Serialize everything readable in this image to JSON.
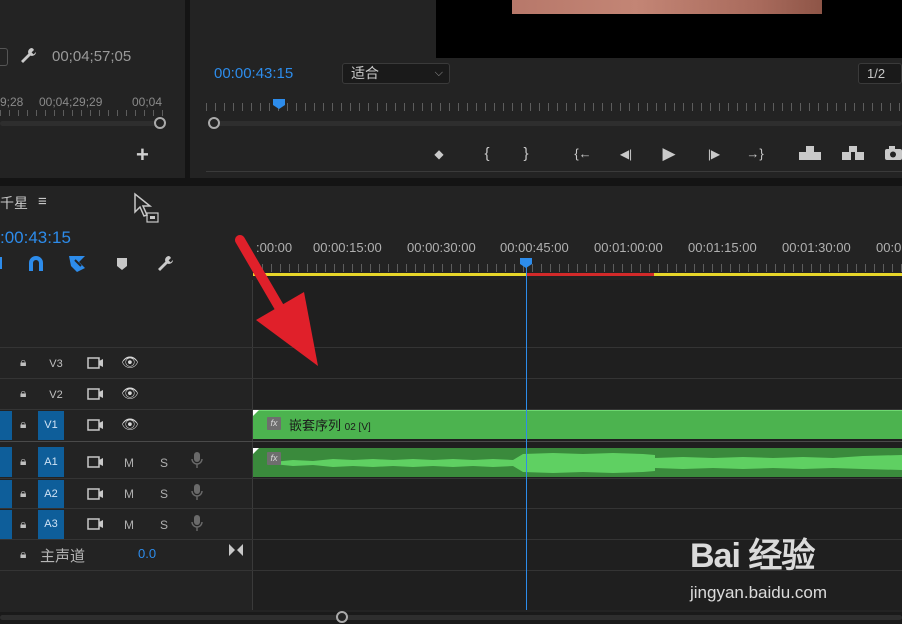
{
  "source_monitor": {
    "duration": "00;04;57;05",
    "ruler_labels": [
      "9;28",
      "00;04;29;29",
      "00;04"
    ],
    "add_label": "+"
  },
  "program_monitor": {
    "timecode": "00:00:43:15",
    "fit_value": "适合",
    "resolution": "1/2",
    "controls": [
      "◆",
      "{",
      "}",
      "{←",
      "◀|",
      "▶",
      "|▶",
      "→}",
      "⊓",
      "⊔",
      "📷"
    ],
    "control_names": [
      "add-marker",
      "mark-in",
      "mark-out",
      "go-to-in",
      "step-back",
      "play",
      "step-forward",
      "go-to-out",
      "lift",
      "extract",
      "export-frame"
    ]
  },
  "timeline": {
    "sequence_name": "千星",
    "menu_icon": "≡",
    "timecode": ":00:43:15",
    "ruler_labels": [
      ":00:00",
      "00:00:15:00",
      "00:00:30:00",
      "00:00:45:00",
      "00:01:00:00",
      "00:01:15:00",
      "00:01:30:00",
      "00:0"
    ],
    "video_tracks": [
      {
        "id": "V3",
        "selected": false
      },
      {
        "id": "V2",
        "selected": false
      },
      {
        "id": "V1",
        "selected": true
      }
    ],
    "audio_tracks": [
      {
        "id": "A1",
        "mute": "M",
        "solo": "S"
      },
      {
        "id": "A2",
        "mute": "M",
        "solo": "S"
      },
      {
        "id": "A3",
        "mute": "M",
        "solo": "S"
      }
    ],
    "master": {
      "label": "主声道",
      "value": "0.0"
    },
    "clip_video": {
      "name": "嵌套序列",
      "suffix": "02 [V]",
      "fx": "fx"
    },
    "clip_audio": {
      "fx": "fx"
    }
  },
  "watermark": {
    "logo": "Bai 经验",
    "url": "jingyan.baidu.com"
  },
  "colors": {
    "accent": "#2d8ceb",
    "clip_video": "#4cb34f",
    "clip_audio": "#3a8a3c",
    "work_area": "#e8d72a",
    "render_bar": "#d32a2a",
    "arrow": "#e0202a"
  }
}
